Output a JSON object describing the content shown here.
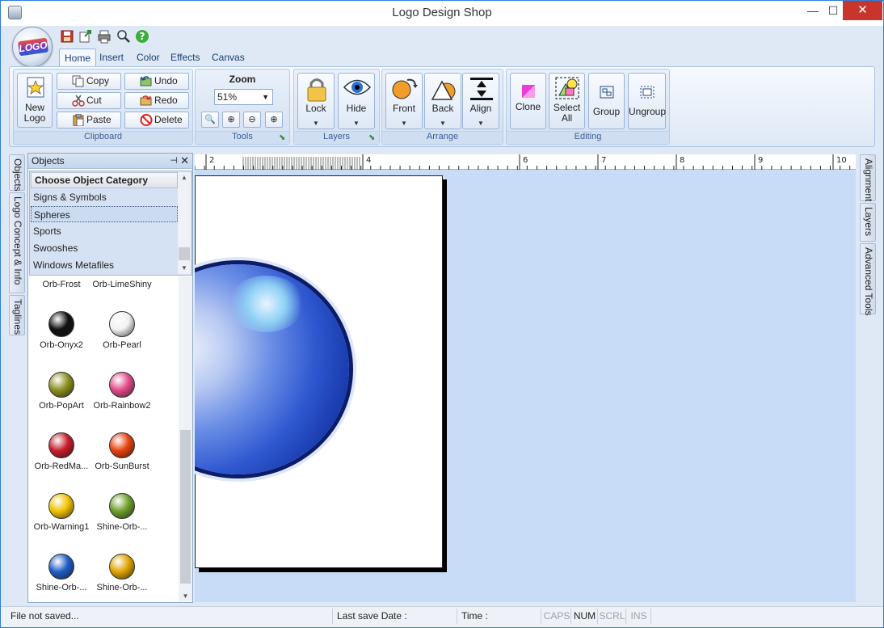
{
  "window": {
    "title": "Logo Design Shop",
    "minimize": "—",
    "maximize": "☐",
    "close": "✕"
  },
  "app_logo_text": "LOGO",
  "quick_access": [
    "save-icon",
    "export-icon",
    "print-icon",
    "preview-icon",
    "help-icon"
  ],
  "tabs": [
    "Home",
    "Insert",
    "Color",
    "Effects",
    "Canvas"
  ],
  "active_tab": "Home",
  "ribbon": {
    "clipboard": {
      "label": "Clipboard",
      "new_logo": "New Logo",
      "copy": "Copy",
      "cut": "Cut",
      "paste": "Paste",
      "undo": "Undo",
      "redo": "Redo",
      "delete": "Delete"
    },
    "tools": {
      "label": "Tools",
      "zoom_label": "Zoom",
      "zoom_value": "51%"
    },
    "layers": {
      "label": "Layers",
      "lock": "Lock",
      "hide": "Hide"
    },
    "arrange": {
      "label": "Arrange",
      "front": "Front",
      "back": "Back",
      "align": "Align"
    },
    "editing": {
      "label": "Editing",
      "clone": "Clone",
      "select_all": "Select All",
      "group": "Group",
      "ungroup": "Ungroup"
    }
  },
  "left_tabs": [
    "Objects",
    "Logo Concept & Info",
    "Taglines"
  ],
  "right_tabs": [
    "Alignment",
    "Layers",
    "Advanced Tools"
  ],
  "objects_panel": {
    "title": "Objects",
    "category_header": "Choose Object Category",
    "categories": [
      "Signs & Symbols",
      "Spheres",
      "Sports",
      "Swooshes",
      "Windows Metafiles"
    ],
    "selected_category": "Spheres",
    "items": [
      {
        "name": "Orb-Frost",
        "color": "#9ec7e8"
      },
      {
        "name": "Orb-LimeShiny",
        "color": "#9ad64a"
      },
      {
        "name": "Orb-Onyx2",
        "color": "#111111"
      },
      {
        "name": "Orb-Pearl",
        "color": "#f2f2f2"
      },
      {
        "name": "Orb-PopArt",
        "color": "#8c8f1e"
      },
      {
        "name": "Orb-Rainbow2",
        "color": "#e34b8a"
      },
      {
        "name": "Orb-RedMa...",
        "color": "#c81d2a"
      },
      {
        "name": "Orb-SunBurst",
        "color": "#e8410e"
      },
      {
        "name": "Orb-Warning1",
        "color": "#f2c200"
      },
      {
        "name": "Shine-Orb-...",
        "color": "#6f9f2a"
      },
      {
        "name": "Shine-Orb-...",
        "color": "#1f5cc6"
      },
      {
        "name": "Shine-Orb-...",
        "color": "#e0a300"
      }
    ]
  },
  "ruler_labels": [
    "2",
    "4",
    "6",
    "7",
    "8",
    "9",
    "10"
  ],
  "status": {
    "file": "File not saved...",
    "last_save": "Last save Date :",
    "time": "Time :",
    "caps": "CAPS",
    "num": "NUM",
    "scrl": "SCRL",
    "ins": "INS"
  }
}
